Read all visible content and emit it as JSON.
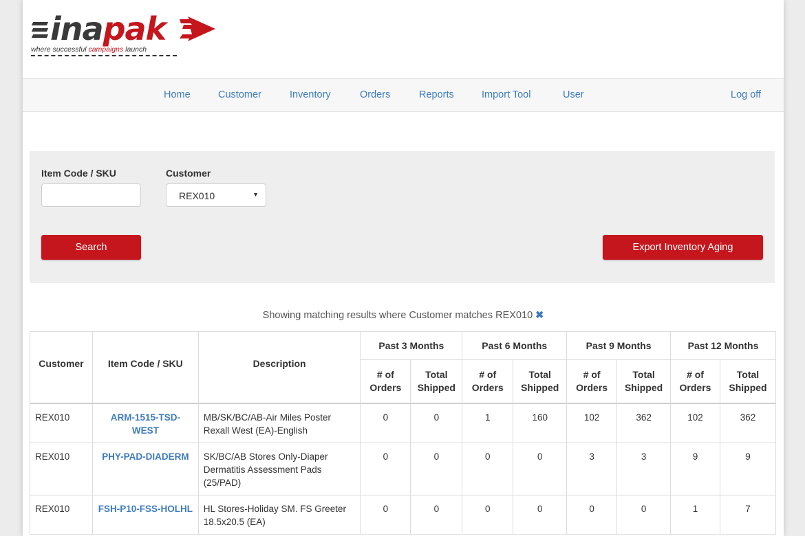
{
  "brand": {
    "wordmark_a": "inapak",
    "tagline_pre": "where successful ",
    "tagline_highlight": "campaigns",
    "tagline_post": " launch",
    "colors": {
      "red": "#c4161c",
      "gray": "#3a3a3a",
      "link": "#3d7bbf"
    }
  },
  "nav": {
    "items": [
      "Home",
      "Customer",
      "Inventory",
      "Orders",
      "Reports",
      "Import Tool",
      "User"
    ],
    "logoff": "Log off"
  },
  "filters": {
    "item_label": "Item Code / SKU",
    "item_value": "",
    "customer_label": "Customer",
    "customer_value": "REX010",
    "search_button": "Search",
    "export_button": "Export Inventory Aging"
  },
  "results_message": "Showing matching results where Customer matches REX010",
  "clear_icon": "close-icon",
  "table": {
    "col_customer": "Customer",
    "col_sku": "Item Code / SKU",
    "col_description": "Description",
    "groups": [
      "Past 3 Months",
      "Past 6 Months",
      "Past 9 Months",
      "Past 12 Months"
    ],
    "sub_orders": "# of Orders",
    "sub_shipped": "Total Shipped",
    "rows": [
      {
        "customer": "REX010",
        "sku": "ARM-1515-TSD-WEST",
        "description": "MB/SK/BC/AB-Air Miles Poster Rexall West (EA)-English",
        "values": [
          "0",
          "0",
          "1",
          "160",
          "102",
          "362",
          "102",
          "362"
        ]
      },
      {
        "customer": "REX010",
        "sku": "PHY-PAD-DIADERM",
        "description": "SK/BC/AB Stores Only-Diaper Dermatitis Assessment Pads (25/PAD)",
        "values": [
          "0",
          "0",
          "0",
          "0",
          "3",
          "3",
          "9",
          "9"
        ]
      },
      {
        "customer": "REX010",
        "sku": "FSH-P10-FSS-HOLHL",
        "description": "HL Stores-Holiday SM. FS Greeter 18.5x20.5 (EA)",
        "values": [
          "0",
          "0",
          "0",
          "0",
          "0",
          "0",
          "1",
          "7"
        ]
      }
    ]
  }
}
